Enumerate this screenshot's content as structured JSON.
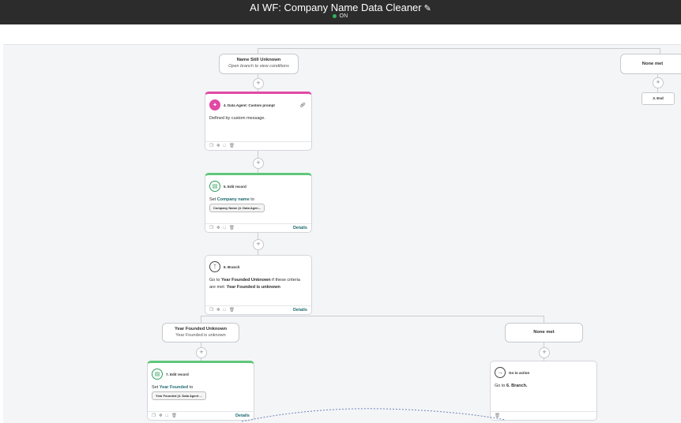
{
  "header": {
    "title": "AI WF: Company Name Data Cleaner",
    "status": "ON"
  },
  "branches": {
    "name_unknown": {
      "title": "Name Still Unknown",
      "subtitle": "Open branch to view conditions"
    },
    "none_met_top": {
      "title": "None met"
    },
    "year_unknown": {
      "title": "Year Founded Unknown",
      "subtitle": "Year Founded is unknown"
    },
    "none_met_bottom": {
      "title": "None met"
    }
  },
  "end_step": {
    "label": "3. End"
  },
  "cards": {
    "data_agent": {
      "title": "4. Data Agent: Custom prompt",
      "body": "Defined by custom message."
    },
    "edit5": {
      "title": "5. Edit record",
      "set_prefix": "Set",
      "field": "Company name",
      "to": "to",
      "chip": "Company Name (4. Data Agen...",
      "details": "Details"
    },
    "branch6": {
      "title": "6. Branch",
      "go_to": "Go to",
      "target": "Year Founded Unknown",
      "mid": "if these criteria are met:",
      "criteria": "Year Founded is unknown",
      "details": "Details"
    },
    "edit7": {
      "title": "7. Edit record",
      "set_prefix": "Set",
      "field": "Year Founded",
      "to": "to",
      "chip": "Year Founded (4. Data Agent ...",
      "details": "Details"
    },
    "goto": {
      "title": "Go to action",
      "go_to": "Go to",
      "target": "6. Branch."
    }
  },
  "icons": {
    "edit": "pencil-icon",
    "agent": "sparkle-icon",
    "record": "record-icon",
    "branch": "branch-icon",
    "goto": "arrow-right-icon"
  },
  "colors": {
    "topbar": "#2c2c2c",
    "on": "#2fb35b",
    "agent": "#e04aa6",
    "record": "#5fc77a",
    "link": "#1e6b72"
  }
}
